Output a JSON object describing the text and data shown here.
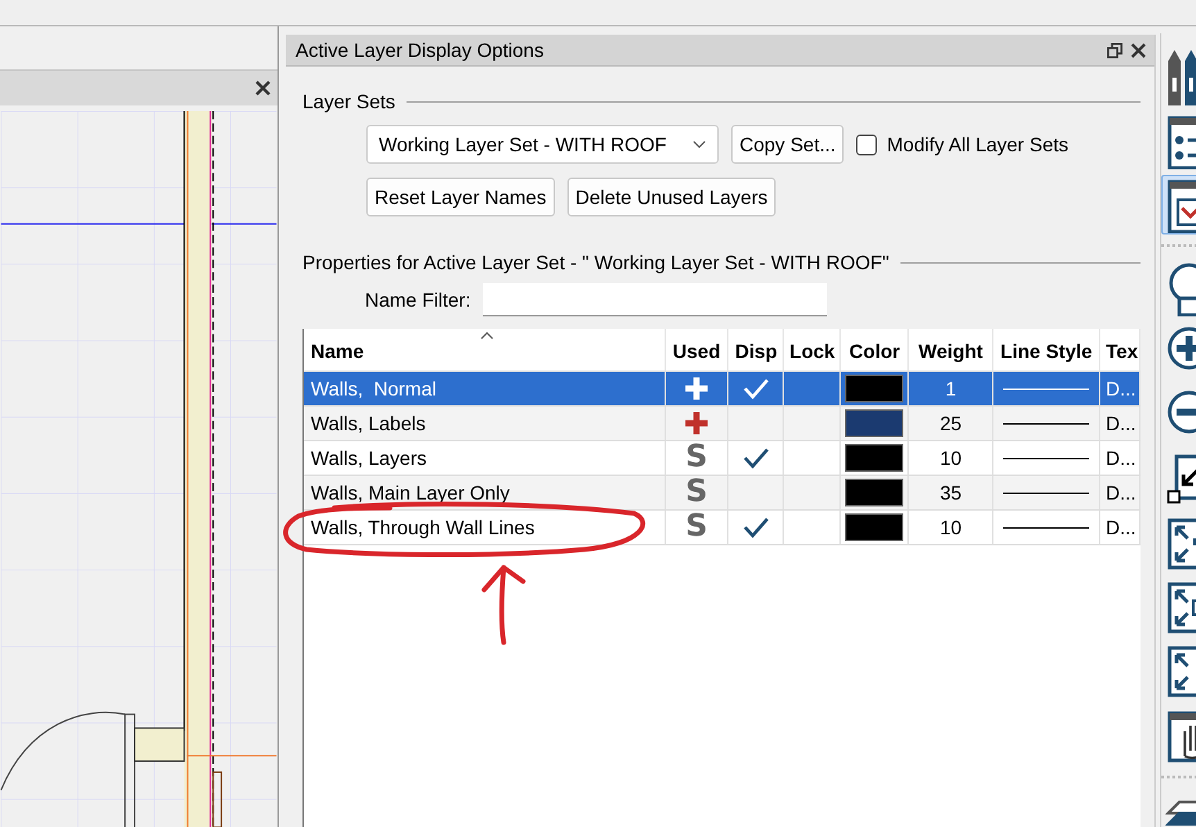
{
  "dialog": {
    "title": "Active Layer Display Options"
  },
  "layer_sets": {
    "heading": "Layer Sets",
    "dropdown": {
      "value": "Working Layer Set - WITH ROOF"
    },
    "copy_button": "Copy Set...",
    "checkbox": {
      "label": "Modify All Layer Sets",
      "checked": false
    },
    "buttons": [
      "Reset Layer Names",
      "Delete Unused Layers"
    ]
  },
  "properties": {
    "heading": "Properties for Active Layer Set - \" Working Layer Set - WITH ROOF\"",
    "name_filter": {
      "label": "Name Filter:"
    }
  },
  "table": {
    "columns": [
      "Name",
      "Used",
      "Disp",
      "Lock",
      "Color",
      "Weight",
      "Line Style",
      "Tex"
    ],
    "rows": [
      {
        "name": "Walls,  Normal",
        "used": {
          "kind": "plus"
        },
        "disp": true,
        "color": "#000000",
        "weight": "1",
        "text": "D...",
        "selected": true
      },
      {
        "name": "Walls, Labels",
        "used": {
          "kind": "plus"
        },
        "disp": false,
        "color": "#1b3a70",
        "weight": "25",
        "text": "D...",
        "selected": false
      },
      {
        "name": "Walls, Layers",
        "used": {
          "kind": "letter",
          "text": "S"
        },
        "disp": true,
        "color": "#000000",
        "weight": "10",
        "text": "D...",
        "selected": false
      },
      {
        "name": "Walls, Main Layer Only",
        "used": {
          "kind": "letter",
          "text": "S"
        },
        "disp": false,
        "color": "#000000",
        "weight": "35",
        "text": "D...",
        "selected": false
      },
      {
        "name": "Walls, Through Wall Lines",
        "used": {
          "kind": "letter",
          "text": "S"
        },
        "disp": true,
        "color": "#000000",
        "weight": "10",
        "text": "D...",
        "selected": false
      }
    ]
  },
  "toolbar": [
    {
      "kind": "pens",
      "selected": false
    },
    {
      "kind": "list",
      "selected": false
    },
    {
      "kind": "layer-sets",
      "selected": true
    },
    {
      "kind": "separator"
    },
    {
      "kind": "circle",
      "selected": false
    },
    {
      "kind": "plus",
      "selected": false
    },
    {
      "kind": "minus",
      "selected": false
    },
    {
      "kind": "arrow-in",
      "selected": false
    },
    {
      "kind": "expand-dots",
      "selected": false
    },
    {
      "kind": "expand-box",
      "selected": false
    },
    {
      "kind": "expand",
      "selected": false
    },
    {
      "kind": "hand",
      "selected": false
    },
    {
      "kind": "separator"
    },
    {
      "kind": "layers",
      "selected": false
    }
  ]
}
